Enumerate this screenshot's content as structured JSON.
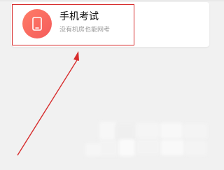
{
  "exam_card": {
    "icon": "tablet-icon",
    "title": "手机考试",
    "subtitle": "没有机房也能网考"
  },
  "annotation": {
    "arrow_color": "#d72c2c",
    "highlight_color": "#d72c2c"
  },
  "colors": {
    "background": "#f1f1f1",
    "card_background": "#ffffff",
    "icon_gradient_start": "#ff7c67",
    "icon_gradient_end": "#f45b5b",
    "title": "#111111",
    "subtitle": "#9a9a9a"
  }
}
